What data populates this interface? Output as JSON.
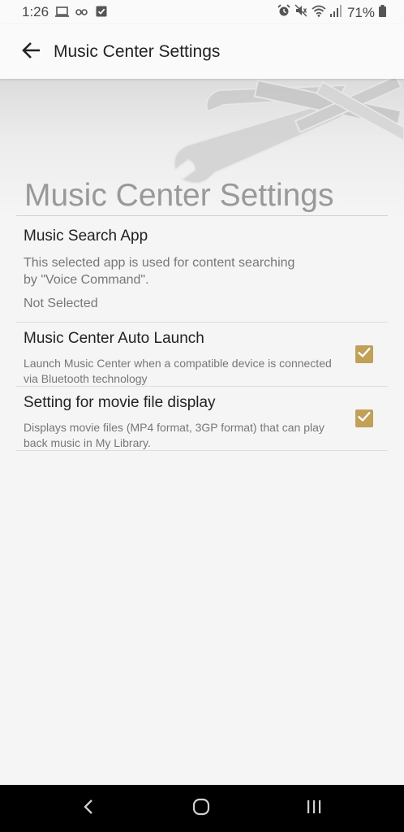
{
  "status_bar": {
    "time": "1:26",
    "left_icons": [
      "laptop-icon",
      "key-icon",
      "checkbox-notification-icon"
    ],
    "right_icons": [
      "alarm-icon",
      "mute-icon",
      "wifi-icon",
      "signal-icon",
      "battery-icon"
    ],
    "battery": "71%"
  },
  "app_bar": {
    "title": "Music Center Settings",
    "back_icon": "arrow-left-icon"
  },
  "header": {
    "image_icon": "wrench-tools-icon"
  },
  "page": {
    "heading": "Music Center Settings"
  },
  "settings": {
    "search": {
      "title": "Music Search App",
      "summary": "This selected app is used for content searching by \"Voice Command\".",
      "value": "Not Selected"
    },
    "auto_launch": {
      "title": "Music Center Auto Launch",
      "summary": "Launch Music Center when a compatible device is connected via Bluetooth technology",
      "checked": true
    },
    "movie_display": {
      "title": "Setting for movie file display",
      "summary": "Displays movie files (MP4 format, 3GP format) that can play back music in My Library.",
      "checked": true
    }
  },
  "nav_bar": {
    "buttons": [
      "back-nav-icon",
      "home-icon",
      "recent-apps-icon"
    ]
  },
  "colors": {
    "accent": "#c1a057",
    "background": "#f5f5f5",
    "nav_background": "#000000"
  }
}
